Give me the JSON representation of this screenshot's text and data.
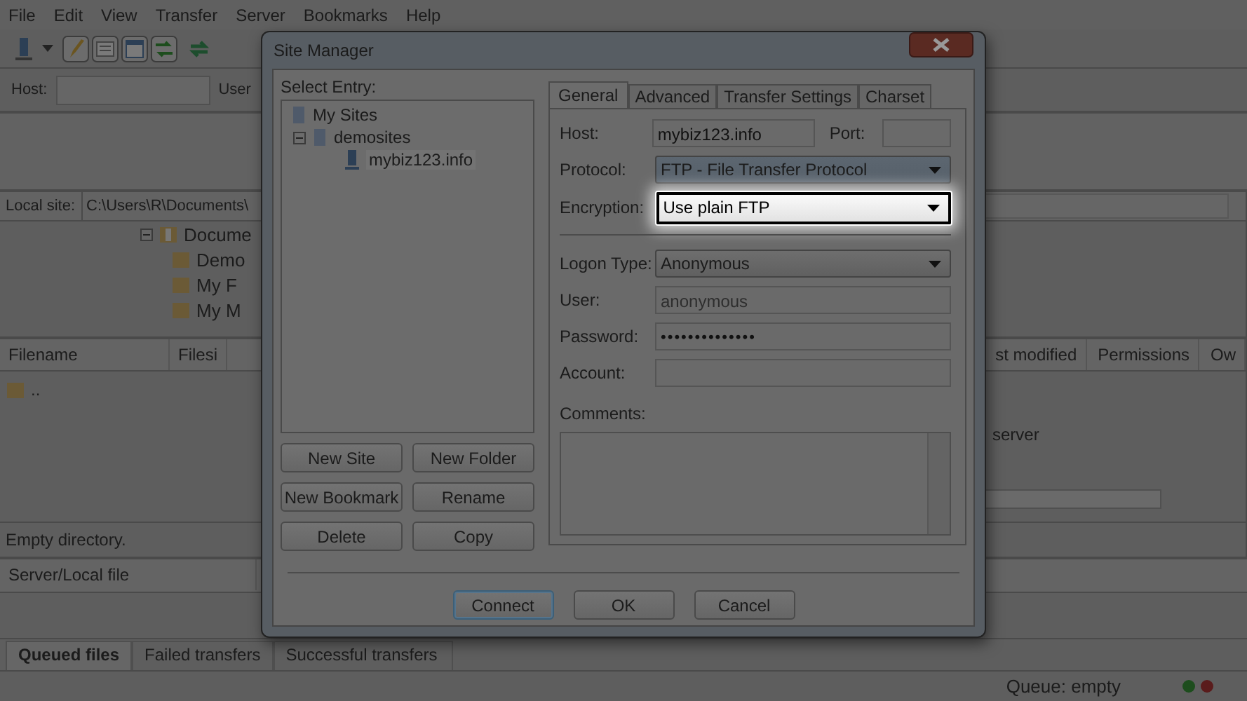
{
  "menu_bar": [
    "File",
    "Edit",
    "View",
    "Transfer",
    "Server",
    "Bookmarks",
    "Help"
  ],
  "quickconnect": {
    "host_label": "Host:",
    "user_label": "User"
  },
  "local_site": {
    "label": "Local site:",
    "path": "C:\\Users\\R\\Documents\\"
  },
  "local_tree": [
    {
      "label": "Docume",
      "expanded": true,
      "children": [
        {
          "label": "Demo"
        },
        {
          "label": "My F"
        },
        {
          "label": "My M"
        }
      ]
    }
  ],
  "local_files": {
    "columns": [
      "Filename",
      "Filesi"
    ],
    "rows": [
      ".."
    ],
    "status": "Empty directory."
  },
  "remote_files": {
    "columns": [
      "st modified",
      "Permissions",
      "Ow"
    ],
    "message": "server"
  },
  "queue": {
    "columns": [
      "Server/Local file"
    ]
  },
  "queue_tabs": [
    {
      "label": "Queued files",
      "selected": true
    },
    {
      "label": "Failed transfers",
      "selected": false
    },
    {
      "label": "Successful transfers",
      "selected": false
    }
  ],
  "status_bar": {
    "queue": "Queue: empty",
    "indicators": [
      {
        "color": "#1d4d1d"
      },
      {
        "color": "#5a1c1c"
      }
    ]
  },
  "dialog": {
    "title": "Site Manager",
    "select_entry_label": "Select Entry:",
    "site_tree": [
      {
        "label": "My Sites",
        "children": [
          {
            "label": "demosites",
            "expanded": true,
            "children": [
              {
                "label": "mybiz123.info",
                "selected": true
              }
            ]
          }
        ]
      }
    ],
    "entry_buttons": [
      "New Site",
      "New Folder",
      "New Bookmark",
      "Rename",
      "Delete",
      "Copy"
    ],
    "tabs": [
      {
        "label": "General",
        "selected": true
      },
      {
        "label": "Advanced",
        "selected": false
      },
      {
        "label": "Transfer Settings",
        "selected": false
      },
      {
        "label": "Charset",
        "selected": false
      }
    ],
    "host": {
      "label": "Host:",
      "value": "mybiz123.info"
    },
    "port": {
      "label": "Port:"
    },
    "protocol": {
      "label": "Protocol:",
      "value": "FTP - File Transfer Protocol",
      "highlighted": false
    },
    "encryption": {
      "label": "Encryption:",
      "value": "Use plain FTP",
      "highlighted": true
    },
    "logon_type": {
      "label": "Logon Type:",
      "value": "Anonymous",
      "highlighted": false
    },
    "user": {
      "label": "User:",
      "value": "anonymous",
      "disabled": true
    },
    "password": {
      "label": "Password:",
      "value": "••••••••••••••"
    },
    "account": {
      "label": "Account:"
    },
    "comments": {
      "label": "Comments:"
    },
    "footer_buttons": [
      {
        "label": "Connect",
        "default": true
      },
      {
        "label": "OK",
        "default": false
      },
      {
        "label": "Cancel",
        "default": false
      }
    ]
  }
}
